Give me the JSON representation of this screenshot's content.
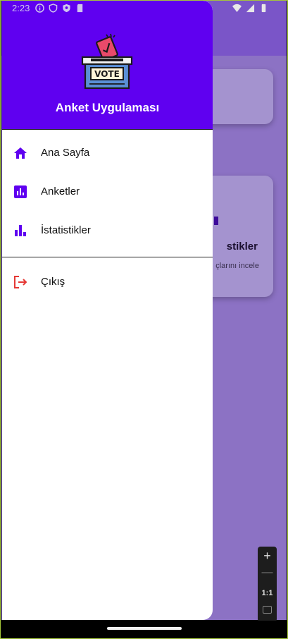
{
  "status_bar": {
    "time": "2:23",
    "left_icons": [
      "info-icon",
      "shield-icon",
      "privacy-icon",
      "sd-card-icon"
    ],
    "right_icons": [
      "wifi-icon",
      "signal-icon",
      "battery-icon"
    ]
  },
  "drawer": {
    "title": "Anket Uygulaması",
    "logo_text": "VOTE",
    "colors": {
      "header": "#5f00f0",
      "icon": "#5f00f0",
      "logout_icon": "#e53935"
    },
    "items": [
      {
        "label": "Ana Sayfa",
        "icon": "home-icon"
      },
      {
        "label": "Anketler",
        "icon": "poll-icon"
      },
      {
        "label": "İstatistikler",
        "icon": "bar-chart-icon"
      }
    ],
    "logout": {
      "label": "Çıkış",
      "icon": "logout-icon"
    }
  },
  "background": {
    "card_title_fragment": "stikler",
    "card_subtitle_fragment": "çlarını incele"
  },
  "zoom_controls": {
    "plus": "+",
    "minus": "—",
    "ratio": "1:1"
  }
}
